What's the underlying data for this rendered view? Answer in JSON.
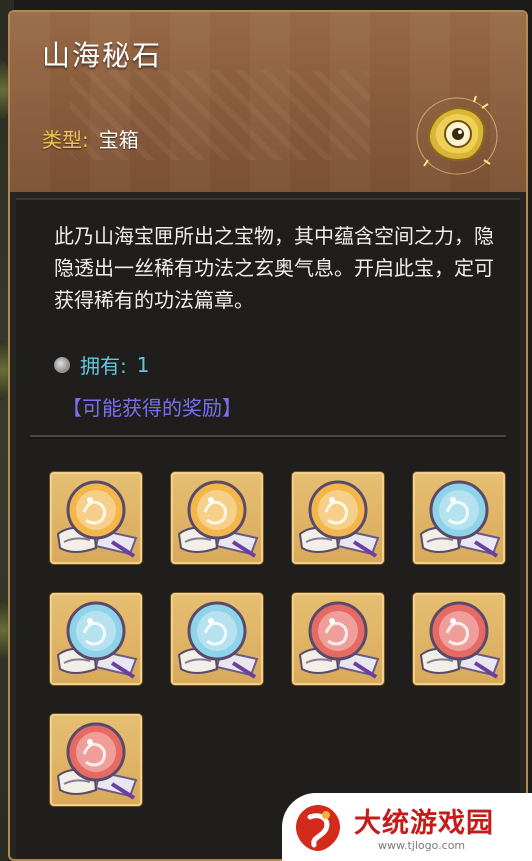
{
  "item": {
    "title": "山海秘石",
    "type_label": "类型:",
    "type_value": "宝箱",
    "icon": "golden-rune-stone-icon"
  },
  "description": "此乃山海宝匣所出之宝物，其中蕴含空间之力，隐隐透出一丝稀有功法之玄奥气息。开启此宝，定可获得稀有的功法篇章。",
  "owned": {
    "label": "拥有:",
    "count": "1"
  },
  "rewards": {
    "title": "【可能获得的奖励】",
    "items": [
      {
        "icon": "gold-scroll-orb-icon",
        "color": "#f2b64a"
      },
      {
        "icon": "gold-scroll-orb-icon",
        "color": "#f2b64a"
      },
      {
        "icon": "gold-scroll-orb-icon",
        "color": "#f2b64a"
      },
      {
        "icon": "blue-scroll-orb-icon",
        "color": "#8fd3e8"
      },
      {
        "icon": "blue-scroll-orb-icon",
        "color": "#8fd3e8"
      },
      {
        "icon": "blue-scroll-orb-icon",
        "color": "#8fd3e8"
      },
      {
        "icon": "red-scroll-orb-icon",
        "color": "#e66a64"
      },
      {
        "icon": "red-scroll-orb-icon",
        "color": "#e66a64"
      },
      {
        "icon": "red-scroll-orb-icon",
        "color": "#e66a64"
      }
    ]
  },
  "watermark": {
    "brand": "大统游戏园",
    "url": "www.tjlogo.com"
  },
  "colors": {
    "frame": "#b08a52",
    "header": "#8a5c3c",
    "type_label": "#f1c64e",
    "owned": "#63c8e0",
    "rewards_title": "#7c6ef0"
  }
}
